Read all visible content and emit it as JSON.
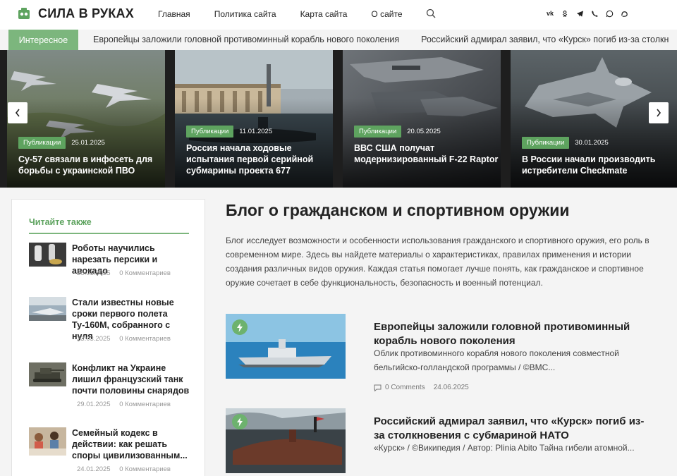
{
  "header": {
    "logo": "СИЛА В РУКАХ",
    "nav": [
      "Главная",
      "Политика сайта",
      "Карта сайта",
      "О сайте"
    ],
    "social_icons": [
      "vk-icon",
      "odnoklassniki-icon",
      "telegram-icon",
      "viber-icon",
      "whatsapp-icon",
      "max-icon"
    ]
  },
  "ticker": {
    "label": "Интересное",
    "items": [
      "Европейцы заложили головной противоминный корабль нового поколения",
      "Российский адмирал заявил, что «Курск» погиб из-за столкн"
    ]
  },
  "slider": {
    "slides": [
      {
        "badge": "Публикации",
        "date": "25.01.2025",
        "title": "Су-57 связали в инфосеть для борьбы с украинской ПВО"
      },
      {
        "badge": "Публикации",
        "date": "11.01.2025",
        "title": "Россия начала ходовые испытания первой серийной субмарины проекта 677"
      },
      {
        "badge": "Публикации",
        "date": "20.05.2025",
        "title": "ВВС США получат модернизированный F-22 Raptor"
      },
      {
        "badge": "Публикации",
        "date": "30.01.2025",
        "title": "В России начали производить истребители Checkmate"
      }
    ]
  },
  "sidebar": {
    "title": "Читайте также",
    "items": [
      {
        "title": "Роботы научились нарезать персики и авокадо",
        "date": "26.01.2025",
        "comments": "0 Комментариев"
      },
      {
        "title": "Стали известны новые сроки первого полета Ту-160М, собранного с нуля",
        "date": "23.03.2025",
        "comments": "0 Комментариев"
      },
      {
        "title": "Конфликт на Украине лишил французский танк почти половины снарядов",
        "date": "29.01.2025",
        "comments": "0 Комментариев"
      },
      {
        "title": "Семейный кодекс в действии: как решать споры цивилизованным...",
        "date": "24.01.2025",
        "comments": "0 Комментариев"
      }
    ]
  },
  "main": {
    "title": "Блог о гражданском и спортивном оружии",
    "description": "Блог исследует возможности и особенности использования гражданского и спортивного оружия, его роль в современном мире. Здесь вы найдете материалы о характеристиках, правилах применения и истории создания различных видов оружия. Каждая статья помогает лучше понять, как гражданское и спортивное оружие сочетает в себе функциональность, безопасность и военный потенциал.",
    "posts": [
      {
        "title": "Европейцы заложили головной противоминный корабль нового поколения",
        "excerpt": "Облик противоминного корабля нового поколения совместной бельгийско-голландской программы / ©ВМС...",
        "comments": "0 Comments",
        "date": "24.06.2025"
      },
      {
        "title": "Российский адмирал заявил, что «Курск» погиб из-за столкновения с субмариной НАТО",
        "excerpt": "«Курск» / ©Википедия / Автор: Plinia Abito Тайна гибели атомной...",
        "comments": "",
        "date": ""
      }
    ]
  },
  "colors": {
    "accent": "#7cb67d",
    "badge": "#5ea35f"
  }
}
